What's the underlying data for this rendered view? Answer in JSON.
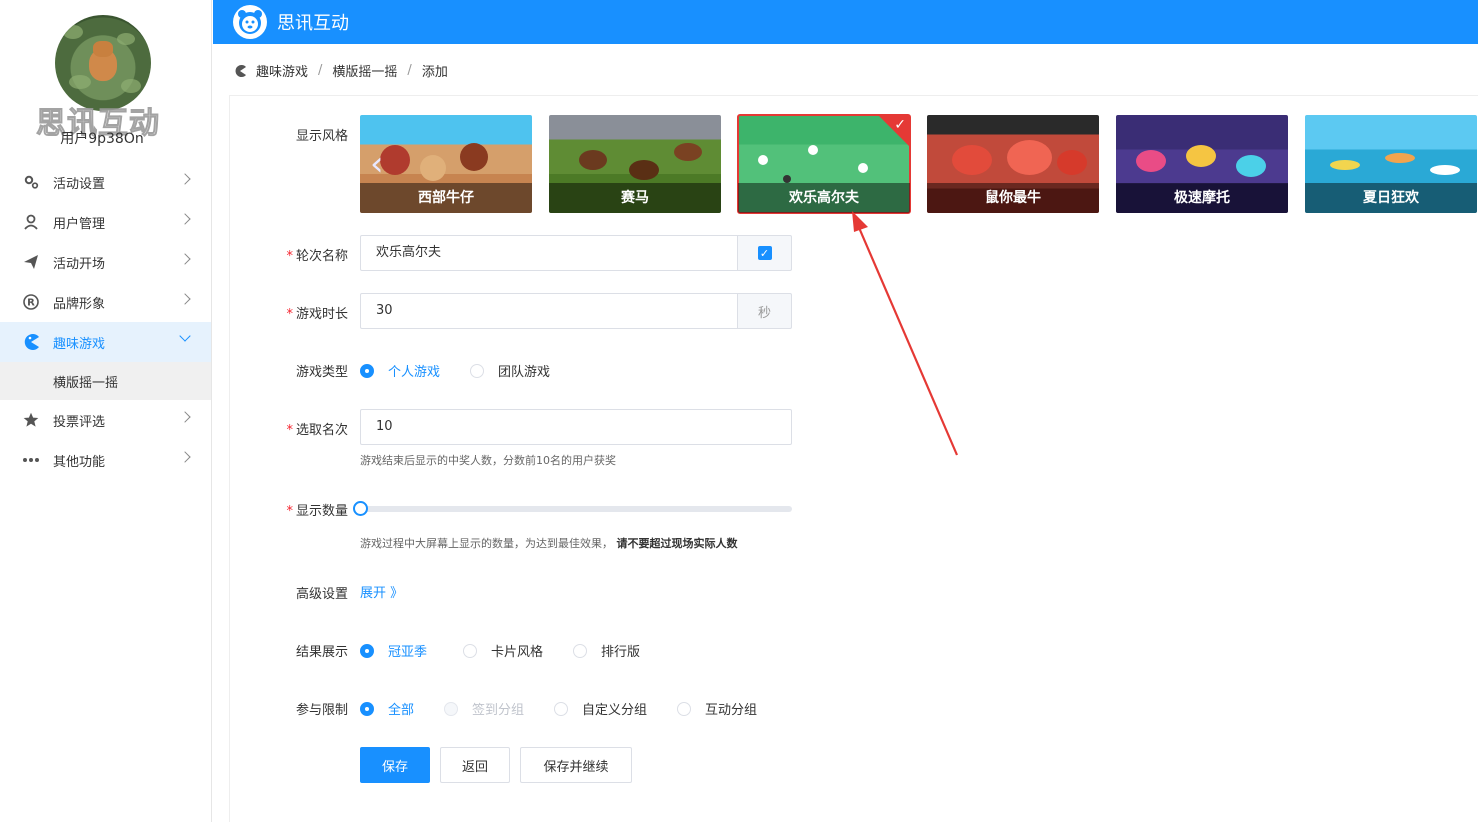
{
  "app": {
    "title": "思讯互动"
  },
  "sidebar": {
    "brand_overlay": "思讯互动",
    "username": "用户9p38On",
    "items": [
      {
        "label": "活动设置",
        "icon": "gears-icon"
      },
      {
        "label": "用户管理",
        "icon": "user-icon"
      },
      {
        "label": "活动开场",
        "icon": "paper-plane-icon"
      },
      {
        "label": "品牌形象",
        "icon": "registered-icon"
      },
      {
        "label": "趣味游戏",
        "icon": "pacman-icon",
        "active": true
      },
      {
        "label": "投票评选",
        "icon": "star-icon"
      },
      {
        "label": "其他功能",
        "icon": "more-dots-icon"
      }
    ],
    "submenu": [
      "横版摇一摇"
    ]
  },
  "breadcrumb": [
    "趣味游戏",
    "横版摇一摇",
    "添加"
  ],
  "form": {
    "style_label": "显示风格",
    "styles": [
      {
        "name": "西部牛仔"
      },
      {
        "name": "赛马"
      },
      {
        "name": "欢乐高尔夫",
        "selected": true
      },
      {
        "name": "鼠你最牛"
      },
      {
        "name": "极速摩托"
      },
      {
        "name": "夏日狂欢"
      }
    ],
    "round_name_label": "轮次名称",
    "round_name_value": "欢乐高尔夫",
    "duration_label": "游戏时长",
    "duration_value": "30",
    "duration_unit": "秒",
    "game_type_label": "游戏类型",
    "game_type_options": [
      "个人游戏",
      "团队游戏"
    ],
    "winners_label": "选取名次",
    "winners_value": "10",
    "winners_hint": "游戏结束后显示的中奖人数，分数前10名的用户获奖",
    "display_count_label": "显示数量",
    "display_count_value": 0,
    "display_count_hint": "游戏过程中大屏幕上显示的数量，为达到最佳效果，",
    "display_count_hint_bold": "请不要超过现场实际人数",
    "advanced_label": "高级设置",
    "advanced_link": "展开 》",
    "result_label": "结果展示",
    "result_options": [
      "冠亚季",
      "卡片风格",
      "排行版"
    ],
    "limit_label": "参与限制",
    "limit_options": [
      "全部",
      "签到分组",
      "自定义分组",
      "互动分组"
    ],
    "buttons": {
      "save": "保存",
      "back": "返回",
      "save_continue": "保存并继续"
    }
  },
  "colors": {
    "primary": "#1890ff",
    "selected_border": "#e53935",
    "required": "#f5222d"
  }
}
